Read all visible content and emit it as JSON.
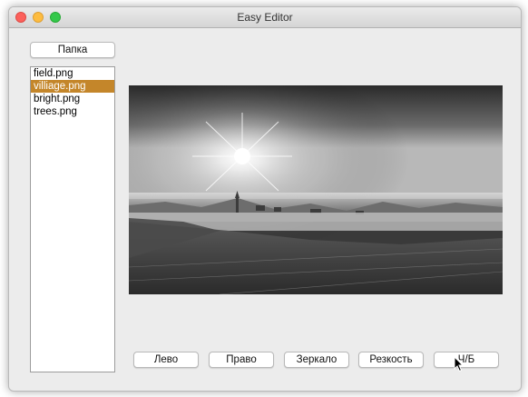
{
  "window": {
    "title": "Easy Editor"
  },
  "folder_button": "Папка",
  "files": [
    {
      "name": "field.png",
      "selected": false
    },
    {
      "name": "villiage.png",
      "selected": true
    },
    {
      "name": "bright.png",
      "selected": false
    },
    {
      "name": "trees.png",
      "selected": false
    }
  ],
  "preview": {
    "image_name": "villiage.png",
    "filter": "grayscale"
  },
  "toolbar": {
    "left": "Лево",
    "right": "Право",
    "mirror": "Зеркало",
    "sharpen": "Резкость",
    "bw": "Ч/Б"
  },
  "colors": {
    "selection": "#c4862a"
  }
}
